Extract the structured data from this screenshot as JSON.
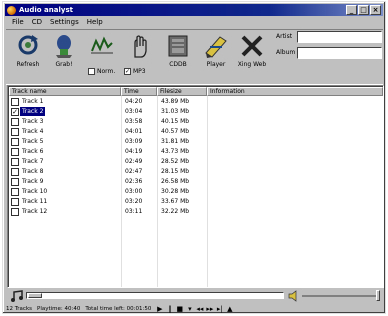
{
  "window": {
    "title": "Audio analyst",
    "min_label": "_",
    "max_label": "□",
    "close_label": "×"
  },
  "menu": [
    "File",
    "CD",
    "Settings",
    "Help"
  ],
  "toolbar": {
    "refresh": "Refresh",
    "grab": "Grab!",
    "norm": "Norm.",
    "norm_checked": false,
    "mp3": "MP3",
    "mp3_checked": true,
    "cddb": "CDDB",
    "player": "Player",
    "xing": "Xing Web",
    "artist_label": "Artist",
    "album_label": "Album",
    "artist_value": "",
    "album_value": ""
  },
  "table": {
    "columns": [
      "Track name",
      "Time",
      "Filesize",
      "Information"
    ],
    "rows": [
      {
        "name": "Track 1",
        "time": "04:20",
        "size": "43.89 Mb",
        "info": "",
        "checked": false,
        "selected": false
      },
      {
        "name": "Track 2",
        "time": "03:04",
        "size": "31.03 Mb",
        "info": "",
        "checked": true,
        "selected": true
      },
      {
        "name": "Track 3",
        "time": "03:58",
        "size": "40.15 Mb",
        "info": "",
        "checked": false,
        "selected": false
      },
      {
        "name": "Track 4",
        "time": "04:01",
        "size": "40.57 Mb",
        "info": "",
        "checked": false,
        "selected": false
      },
      {
        "name": "Track 5",
        "time": "03:09",
        "size": "31.81 Mb",
        "info": "",
        "checked": false,
        "selected": false
      },
      {
        "name": "Track 6",
        "time": "04:19",
        "size": "43.73 Mb",
        "info": "",
        "checked": false,
        "selected": false
      },
      {
        "name": "Track 7",
        "time": "02:49",
        "size": "28.52 Mb",
        "info": "",
        "checked": false,
        "selected": false
      },
      {
        "name": "Track 8",
        "time": "02:47",
        "size": "28.15 Mb",
        "info": "",
        "checked": false,
        "selected": false
      },
      {
        "name": "Track 9",
        "time": "02:36",
        "size": "26.58 Mb",
        "info": "",
        "checked": false,
        "selected": false
      },
      {
        "name": "Track 10",
        "time": "03:00",
        "size": "30.28 Mb",
        "info": "",
        "checked": false,
        "selected": false
      },
      {
        "name": "Track 11",
        "time": "03:20",
        "size": "33.67 Mb",
        "info": "",
        "checked": false,
        "selected": false
      },
      {
        "name": "Track 12",
        "time": "03:11",
        "size": "32.22 Mb",
        "info": "",
        "checked": false,
        "selected": false
      }
    ]
  },
  "status": {
    "tracks": "12 Tracks",
    "playtime": "Playtime: 40:40",
    "timeleft": "Total time left: 00:01:50"
  },
  "colors": {
    "title_bar": "#000080",
    "selection": "#000080",
    "face": "#c0c0c0"
  }
}
